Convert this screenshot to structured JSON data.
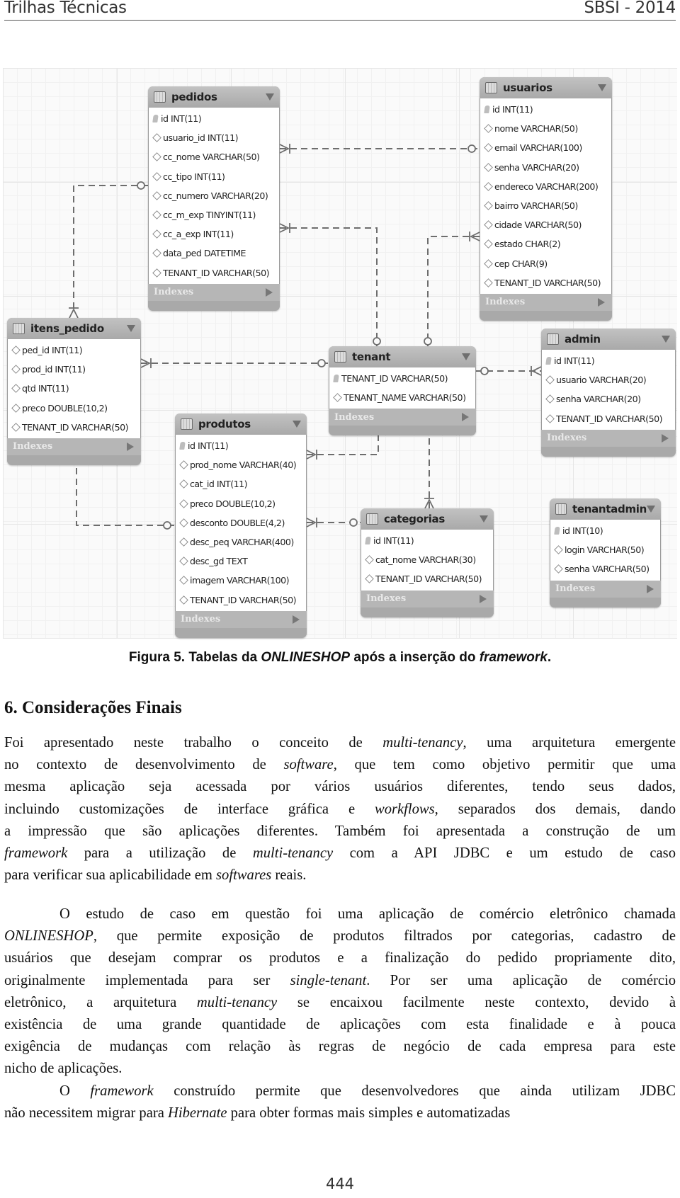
{
  "header": {
    "left": "Trilhas Técnicas",
    "right": "SBSI - 2014"
  },
  "diagram": {
    "index_label": "Indexes",
    "tables": [
      {
        "name": "pedidos",
        "columns": [
          {
            "key": true,
            "text": "id INT(11)"
          },
          {
            "key": false,
            "text": "usuario_id INT(11)"
          },
          {
            "key": false,
            "text": "cc_nome VARCHAR(50)"
          },
          {
            "key": false,
            "text": "cc_tipo INT(11)"
          },
          {
            "key": false,
            "text": "cc_numero VARCHAR(20)"
          },
          {
            "key": false,
            "text": "cc_m_exp TINYINT(11)"
          },
          {
            "key": false,
            "text": "cc_a_exp INT(11)"
          },
          {
            "key": false,
            "text": "data_ped DATETIME"
          },
          {
            "key": false,
            "text": "TENANT_ID VARCHAR(50)"
          }
        ]
      },
      {
        "name": "usuarios",
        "columns": [
          {
            "key": true,
            "text": "id INT(11)"
          },
          {
            "key": false,
            "text": "nome VARCHAR(50)"
          },
          {
            "key": false,
            "text": "email VARCHAR(100)"
          },
          {
            "key": false,
            "text": "senha VARCHAR(20)"
          },
          {
            "key": false,
            "text": "endereco VARCHAR(200)"
          },
          {
            "key": false,
            "text": "bairro VARCHAR(50)"
          },
          {
            "key": false,
            "text": "cidade VARCHAR(50)"
          },
          {
            "key": false,
            "text": "estado CHAR(2)"
          },
          {
            "key": false,
            "text": "cep CHAR(9)"
          },
          {
            "key": false,
            "text": "TENANT_ID VARCHAR(50)"
          }
        ]
      },
      {
        "name": "itens_pedido",
        "columns": [
          {
            "key": false,
            "text": "ped_id INT(11)"
          },
          {
            "key": false,
            "text": "prod_id INT(11)"
          },
          {
            "key": false,
            "text": "qtd INT(11)"
          },
          {
            "key": false,
            "text": "preco DOUBLE(10,2)"
          },
          {
            "key": false,
            "text": "TENANT_ID VARCHAR(50)"
          }
        ]
      },
      {
        "name": "tenant",
        "columns": [
          {
            "key": true,
            "text": "TENANT_ID VARCHAR(50)"
          },
          {
            "key": false,
            "text": "TENANT_NAME VARCHAR(50)"
          }
        ]
      },
      {
        "name": "admin",
        "columns": [
          {
            "key": true,
            "text": "id INT(11)"
          },
          {
            "key": false,
            "text": "usuario VARCHAR(20)"
          },
          {
            "key": false,
            "text": "senha VARCHAR(20)"
          },
          {
            "key": false,
            "text": "TENANT_ID VARCHAR(50)"
          }
        ]
      },
      {
        "name": "produtos",
        "columns": [
          {
            "key": true,
            "text": "id INT(11)"
          },
          {
            "key": false,
            "text": "prod_nome VARCHAR(40)"
          },
          {
            "key": false,
            "text": "cat_id INT(11)"
          },
          {
            "key": false,
            "text": "preco DOUBLE(10,2)"
          },
          {
            "key": false,
            "text": "desconto DOUBLE(4,2)"
          },
          {
            "key": false,
            "text": "desc_peq VARCHAR(400)"
          },
          {
            "key": false,
            "text": "desc_gd TEXT"
          },
          {
            "key": false,
            "text": "imagem VARCHAR(100)"
          },
          {
            "key": false,
            "text": "TENANT_ID VARCHAR(50)"
          }
        ]
      },
      {
        "name": "categorias",
        "columns": [
          {
            "key": true,
            "text": "id INT(11)"
          },
          {
            "key": false,
            "text": "cat_nome VARCHAR(30)"
          },
          {
            "key": false,
            "text": "TENANT_ID VARCHAR(50)"
          }
        ]
      },
      {
        "name": "tenantadmin",
        "columns": [
          {
            "key": true,
            "text": "id INT(10)"
          },
          {
            "key": false,
            "text": "login VARCHAR(50)"
          },
          {
            "key": false,
            "text": "senha VARCHAR(50)"
          }
        ]
      }
    ],
    "relationships": [
      {
        "from": "pedidos",
        "to": "usuarios",
        "from_end": "many-mandatory",
        "to_end": "one-optional"
      },
      {
        "from": "itens_pedido",
        "to": "pedidos",
        "from_end": "many-mandatory",
        "to_end": "one-optional"
      },
      {
        "from": "pedidos",
        "to": "tenant",
        "from_end": "many-mandatory",
        "to_end": "one-optional"
      },
      {
        "from": "usuarios",
        "to": "tenant",
        "from_end": "many-mandatory",
        "to_end": "one-optional"
      },
      {
        "from": "itens_pedido",
        "to": "tenant",
        "from_end": "many-mandatory",
        "to_end": "one-optional"
      },
      {
        "from": "admin",
        "to": "tenant",
        "from_end": "many-mandatory",
        "to_end": "one-optional"
      },
      {
        "from": "itens_pedido",
        "to": "produtos",
        "from_end": "many-mandatory",
        "to_end": "one-optional"
      },
      {
        "from": "produtos",
        "to": "tenant",
        "from_end": "many-mandatory",
        "to_end": "one-optional"
      },
      {
        "from": "categorias",
        "to": "tenant",
        "from_end": "many-mandatory",
        "to_end": "one-optional"
      },
      {
        "from": "produtos",
        "to": "categorias",
        "from_end": "many-mandatory",
        "to_end": "one-optional"
      }
    ]
  },
  "caption": {
    "prefix": "Figura 5. Tabelas da ",
    "em1": "ONLINESHOP",
    "mid": " após a inserção do ",
    "em2": "framework",
    "suffix": "."
  },
  "section_title": "6. Considerações Finais",
  "paragraphs": [
    [
      [
        {
          "t": "Foi apresentado neste trabalho o conceito de "
        },
        {
          "t": "multi-tenancy",
          "i": true
        },
        {
          "t": ", uma arquitetura emergente"
        }
      ],
      [
        {
          "t": "no contexto de desenvolvimento de "
        },
        {
          "t": "software",
          "i": true
        },
        {
          "t": ", que tem como objetivo permitir que uma"
        }
      ],
      [
        {
          "t": "mesma aplicação seja acessada por vários usuários diferentes, tendo seus dados,"
        }
      ],
      [
        {
          "t": "incluindo customizações de interface gráfica e "
        },
        {
          "t": "workflows",
          "i": true
        },
        {
          "t": ", separados dos demais, dando"
        }
      ],
      [
        {
          "t": "a impressão que são aplicações diferentes. Também foi apresentada a construção de um"
        }
      ],
      [
        {
          "t": "framework",
          "i": true
        },
        {
          "t": " para a utilização de "
        },
        {
          "t": "multi-tenancy",
          "i": true
        },
        {
          "t": " com a API JDBC e um estudo de caso"
        }
      ],
      [
        {
          "t": "para verificar sua aplicabilidade em "
        },
        {
          "t": "softwares",
          "i": true
        },
        {
          "t": " reais."
        }
      ]
    ],
    [
      [
        {
          "t": "O estudo de caso em questão foi uma aplicação de comércio eletrônico chamada"
        }
      ],
      [
        {
          "t": "ONLINESHOP",
          "i": true
        },
        {
          "t": ", que permite exposição de produtos filtrados por categorias, cadastro de"
        }
      ],
      [
        {
          "t": "usuários que desejam comprar os produtos e a finalização do pedido propriamente dito,"
        }
      ],
      [
        {
          "t": "originalmente implementada para ser "
        },
        {
          "t": "single-tenant",
          "i": true
        },
        {
          "t": ". Por ser uma aplicação de comércio"
        }
      ],
      [
        {
          "t": "eletrônico, a arquitetura "
        },
        {
          "t": "multi-tenancy",
          "i": true
        },
        {
          "t": " se encaixou facilmente neste contexto, devido à"
        }
      ],
      [
        {
          "t": "existência de uma grande quantidade de aplicações com esta finalidade e à pouca"
        }
      ],
      [
        {
          "t": "exigência de mudanças com relação às regras de negócio de cada empresa para este"
        }
      ],
      [
        {
          "t": "nicho de aplicações."
        }
      ]
    ],
    [
      [
        {
          "t": "O "
        },
        {
          "t": "framework",
          "i": true
        },
        {
          "t": " construído permite que desenvolvedores que ainda utilizam JDBC"
        }
      ],
      [
        {
          "t": "não necessitem migrar para "
        },
        {
          "t": "Hibernate",
          "i": true
        },
        {
          "t": " para obter formas mais simples e automatizadas"
        }
      ]
    ]
  ],
  "page_number": "444"
}
